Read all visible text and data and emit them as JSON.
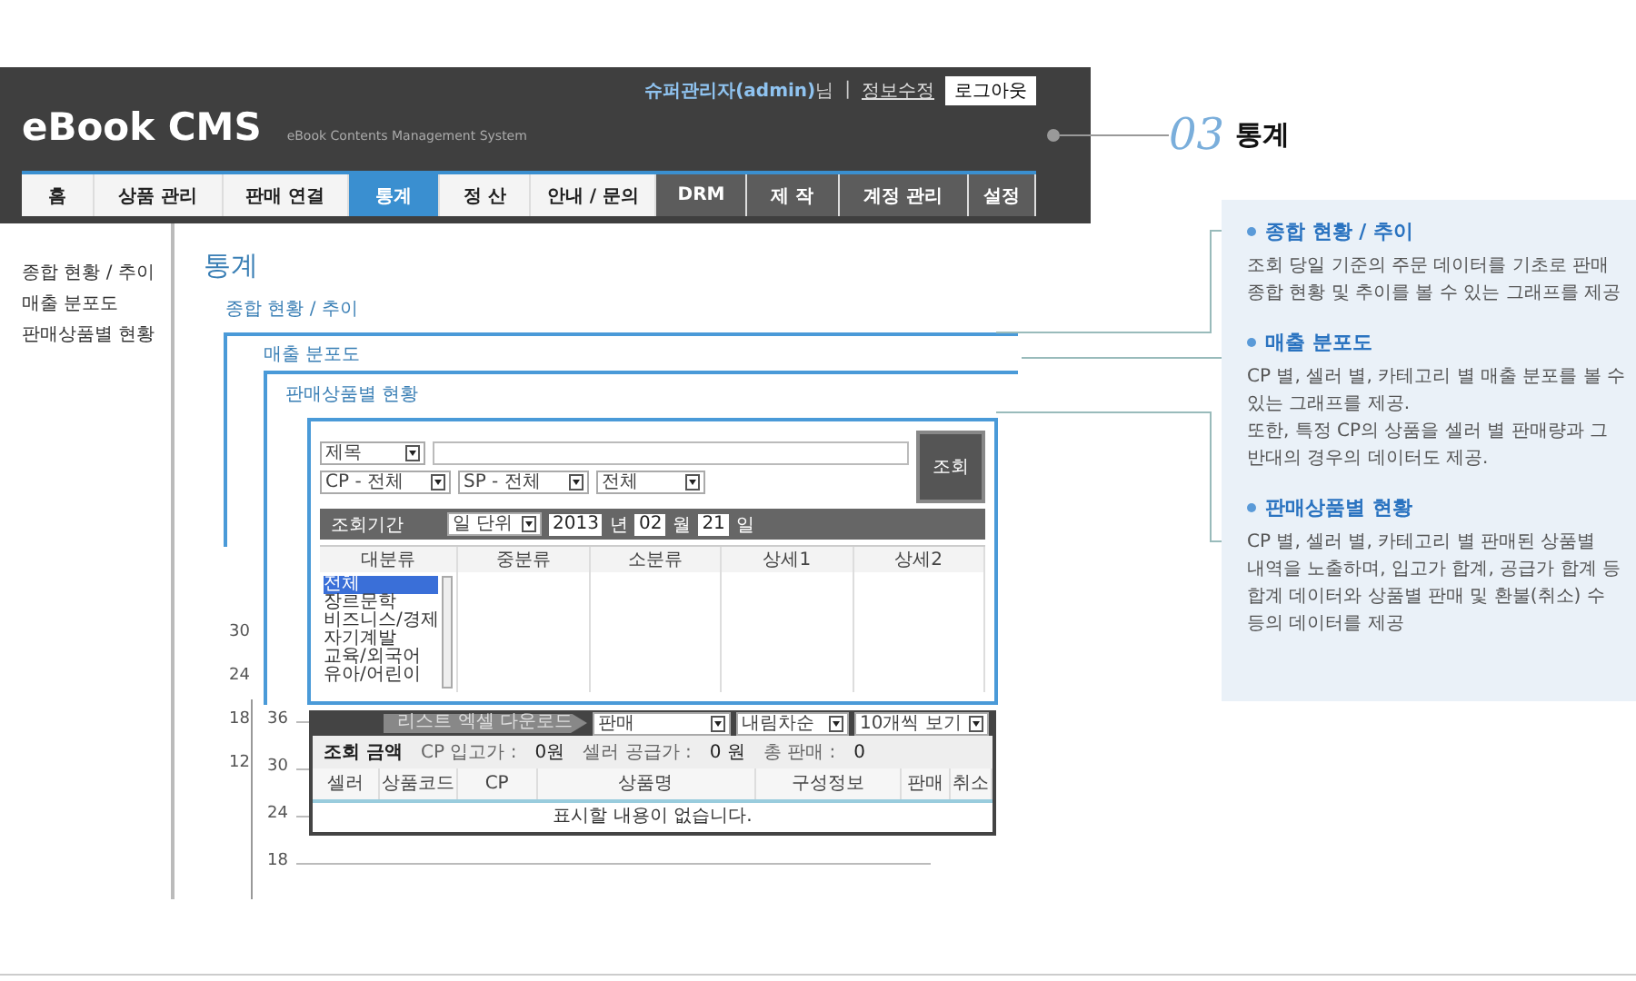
{
  "header": {
    "logo": "eBook CMS",
    "subtitle": "eBook Contents Management System",
    "user": "슈퍼관리자(admin)",
    "user_suffix": "님",
    "separator": "|",
    "edit_link": "정보수정",
    "logout": "로그아웃"
  },
  "nav": [
    {
      "label": "홈",
      "selected": false,
      "kind": "light"
    },
    {
      "label": "상품 관리",
      "selected": false,
      "kind": "light"
    },
    {
      "label": "판매 연결",
      "selected": false,
      "kind": "light"
    },
    {
      "label": "통계",
      "selected": true,
      "kind": "light"
    },
    {
      "label": "정 산",
      "selected": false,
      "kind": "light"
    },
    {
      "label": "안내 / 문의",
      "selected": false,
      "kind": "light"
    },
    {
      "label": "DRM",
      "selected": false,
      "kind": "dark"
    },
    {
      "label": "제 작",
      "selected": false,
      "kind": "dark"
    },
    {
      "label": "계정 관리",
      "selected": false,
      "kind": "dark"
    },
    {
      "label": "설정",
      "selected": false,
      "kind": "dark"
    }
  ],
  "callout": {
    "number": "03",
    "title": "통계"
  },
  "sidebar": [
    "종합 현황 / 추이",
    "매출 분포도",
    "판매상품별 현황"
  ],
  "page_title": "통계",
  "panels": [
    {
      "title": "종합 현황 / 추이",
      "yticks": [
        "30",
        "24",
        "18",
        "12"
      ]
    },
    {
      "title": "매출 분포도",
      "yticks": [
        "36",
        "30",
        "24",
        "18"
      ]
    },
    {
      "title": "판매상품별 현황"
    }
  ],
  "search_form": {
    "title_select": "제목",
    "cp_select": "CP - 전체",
    "sp_select": "SP - 전체",
    "all_select": "전체",
    "period_label": "조회기간",
    "unit_select": "일 단위",
    "year": "2013",
    "year_unit": "년",
    "month": "02",
    "month_unit": "월",
    "day": "21",
    "day_unit": "일",
    "search_button": "조회"
  },
  "category_columns": [
    "대분류",
    "중분류",
    "소분류",
    "상세1",
    "상세2"
  ],
  "category_list": [
    {
      "label": "전체",
      "selected": true
    },
    {
      "label": "장르문학",
      "selected": false
    },
    {
      "label": "비즈니스/경제",
      "selected": false
    },
    {
      "label": "자기계발",
      "selected": false
    },
    {
      "label": "교육/외국어",
      "selected": false
    },
    {
      "label": "유아/어린이",
      "selected": false
    }
  ],
  "results": {
    "excel_button": "리스트 엑셀 다운로드",
    "filter_selects": [
      "판매",
      "내림차순",
      "10개씩 보기"
    ],
    "summary_label": "조회 금액",
    "cp_label": "CP 입고가 :",
    "cp_value": "0원",
    "seller_label": "셀러 공급가 :",
    "seller_value": "0 원",
    "total_label": "총 판매 :",
    "total_value": "0",
    "columns": [
      "셀러",
      "상품코드",
      "CP",
      "상품명",
      "구성정보",
      "판매",
      "취소"
    ],
    "empty": "표시할 내용이 없습니다."
  },
  "info": [
    {
      "title": "종합 현황 / 추이",
      "lines": [
        "조회 당일 기준의 주문 데이터를 기초로 판매",
        "종합 현황 및 추이를 볼 수 있는 그래프를 제공"
      ]
    },
    {
      "title": "매출 분포도",
      "lines": [
        "CP 별, 셀러 별, 카테고리 별 매출 분포를 볼 수",
        "있는 그래프를 제공.",
        "또한, 특정 CP의 상품을 셀러 별 판매량과 그",
        "반대의 경우의 데이터도 제공."
      ]
    },
    {
      "title": "판매상품별 현황",
      "lines": [
        "CP 별, 셀러 별, 카테고리 별 판매된 상품별",
        "내역을 노출하며, 입고가 합계, 공급가 합계 등",
        "합계 데이터와 상품별 판매 및 환불(취소) 수",
        "등의 데이터를 제공"
      ]
    }
  ]
}
